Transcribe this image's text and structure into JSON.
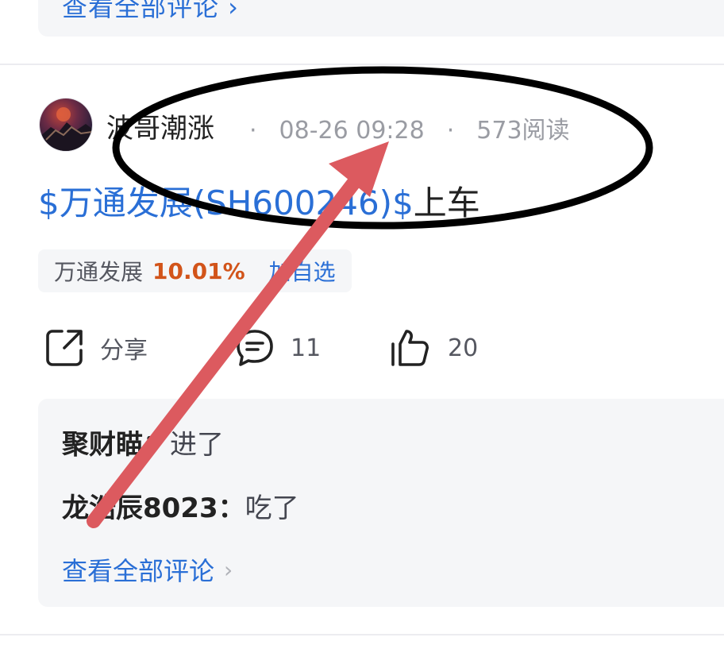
{
  "previous_post": {
    "view_all_comments": "查看全部评论 ›"
  },
  "post": {
    "author": "波哥潮涨",
    "timestamp": "08-26 09:28",
    "reads": "573阅读",
    "separator": "·",
    "stock_link": "$万通发展(SH600246)$",
    "text_suffix": "上车",
    "stock_chip": {
      "name": "万通发展",
      "change_pct": "10.01%",
      "add_watchlist": "加自选"
    },
    "actions": {
      "share_label": "分享",
      "comment_count": "11",
      "like_count": "20"
    },
    "comments": [
      {
        "author": "聚财瞄：",
        "text": "进了"
      },
      {
        "author": "龙浩辰8023：",
        "text": "吃了"
      }
    ],
    "view_all_comments": "查看全部评论"
  },
  "colors": {
    "link_blue": "#2a6fd6",
    "up_orange": "#d2541a",
    "annotation_arrow": "#dc5a5f",
    "annotation_ellipse": "#000000"
  },
  "icons": {
    "share": "share-icon",
    "comment": "comment-icon",
    "like": "thumbs-up-icon",
    "chevron": "chevron-right-icon"
  }
}
